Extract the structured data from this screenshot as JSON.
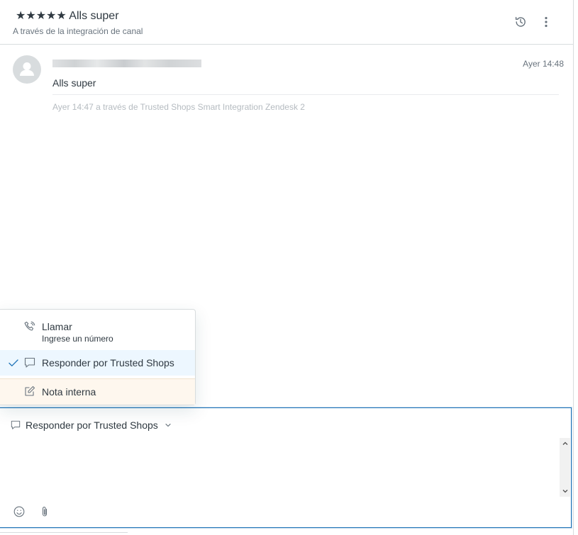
{
  "header": {
    "title": "★★★★★ Alls super",
    "subtitle": "A través de la integración de canal",
    "history_icon": "history-icon",
    "more_icon": "vertical-ellipsis-icon"
  },
  "message": {
    "avatar_icon": "user-avatar-icon",
    "time": "Ayer 14:48",
    "body": "Alls super",
    "meta": "Ayer 14:47 a través de Trusted Shops Smart Integration Zendesk 2"
  },
  "channel_menu": {
    "items": [
      {
        "icon": "phone-icon",
        "label": "Llamar",
        "sublabel": "Ingrese un número",
        "selected": false
      },
      {
        "icon": "speech-bubble-icon",
        "label": "Responder por Trusted Shops",
        "selected": true,
        "check_icon": "checkmark-icon"
      },
      {
        "icon": "note-edit-icon",
        "label": "Nota interna",
        "selected": false
      }
    ]
  },
  "composer": {
    "channel_label": "Responder por Trusted Shops",
    "channel_icon": "speech-bubble-icon",
    "chevron_icon": "chevron-down-icon",
    "emoji_icon": "emoji-icon",
    "attach_icon": "paperclip-icon"
  },
  "colors": {
    "accent": "#1f73b7",
    "text": "#2f3941",
    "muted": "#68737d",
    "selected_bg": "#edf7ff",
    "note_bg": "#fef7ee"
  }
}
